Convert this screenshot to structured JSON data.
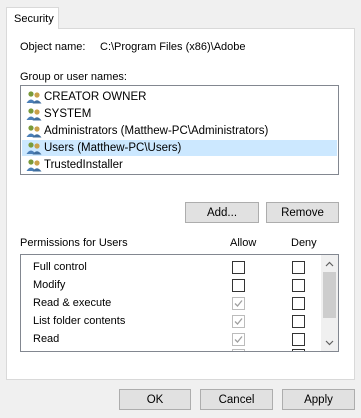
{
  "tabs": [
    {
      "label": "Security"
    }
  ],
  "object_name": {
    "label": "Object name:",
    "value": "C:\\Program Files (x86)\\Adobe"
  },
  "groups": {
    "label": "Group or user names:",
    "items": [
      {
        "name": "CREATOR OWNER"
      },
      {
        "name": "SYSTEM"
      },
      {
        "name": "Administrators (Matthew-PC\\Administrators)"
      },
      {
        "name": "Users (Matthew-PC\\Users)",
        "selected": true
      },
      {
        "name": "TrustedInstaller"
      }
    ]
  },
  "buttons": {
    "add": "Add...",
    "remove": "Remove"
  },
  "permissions": {
    "header": "Permissions for Users",
    "allow_header": "Allow",
    "deny_header": "Deny",
    "rows": [
      {
        "name": "Full control",
        "allow": false,
        "allow_disabled": false,
        "deny": false
      },
      {
        "name": "Modify",
        "allow": false,
        "allow_disabled": false,
        "deny": false
      },
      {
        "name": "Read & execute",
        "allow": true,
        "allow_disabled": true,
        "deny": false
      },
      {
        "name": "List folder contents",
        "allow": true,
        "allow_disabled": true,
        "deny": false
      },
      {
        "name": "Read",
        "allow": true,
        "allow_disabled": true,
        "deny": false
      },
      {
        "name": "",
        "allow": true,
        "allow_disabled": true,
        "deny": false
      }
    ]
  },
  "footer": {
    "ok": "OK",
    "cancel": "Cancel",
    "apply": "Apply"
  },
  "colors": {
    "selection": "#cce8ff",
    "button_face": "#e1e1e1",
    "window_bg": "#f0f0f0"
  }
}
